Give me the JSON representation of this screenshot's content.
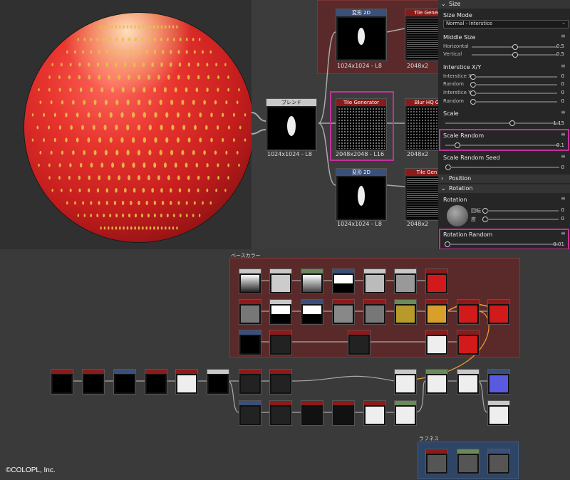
{
  "viewport": {
    "label": "3D Preview"
  },
  "top_graph": {
    "nodes": [
      {
        "title": "変形 2D",
        "caption": "1024x1024 - L8",
        "color": "#3a4f7a"
      },
      {
        "title": "Tile Gener",
        "caption": "2048x2",
        "color": "#8b1a1a"
      },
      {
        "title": "ブレンド",
        "caption": "1024x1024 - L8",
        "color": "#c8c8c8"
      },
      {
        "title": "Tile Generator",
        "caption": "2048x2048 - L16",
        "color": "#8b1a1a"
      },
      {
        "title": "Blur HQ G",
        "caption": "2048x2",
        "color": "#8b1a1a"
      },
      {
        "title": "変形 2D",
        "caption": "1024x1024 - L8",
        "color": "#3a4f7a"
      },
      {
        "title": "Tile Gen",
        "caption": "2048x2",
        "color": "#8b1a1a"
      }
    ]
  },
  "panel": {
    "size_section": "Size",
    "size_mode_label": "Size Mode",
    "size_mode_value": "Normal - Interstice",
    "middle_size_label": "Middle Size",
    "horizontal_label": "Horizontal",
    "horizontal_value": "0.5",
    "horizontal_fraction": 0.5,
    "vertical_label": "Vertical",
    "vertical_value": "0.5",
    "vertical_fraction": 0.5,
    "interstice_label": "Interstice X/Y",
    "interstice_x": "Interstice X",
    "interstice_x_value": "0",
    "random1": "Random",
    "random1_value": "0",
    "interstice_y": "Interstice Y",
    "interstice_y_value": "0",
    "random2": "Random",
    "random2_value": "0",
    "scale_label": "Scale",
    "scale_value": "1.15",
    "scale_fraction": 0.58,
    "scale_random_label": "Scale Random",
    "scale_random_value": "0.1",
    "scale_random_fraction": 0.1,
    "scale_random_seed_label": "Scale Random Seed",
    "scale_random_seed_value": "0",
    "position_section": "Position",
    "rotation_section": "Rotation",
    "rotation_label": "Rotation",
    "rotation_turn_label": "回転",
    "rotation_turn_value": "0",
    "rotation_deg_label": "度",
    "rotation_deg_value": "0",
    "rotation_random_label": "Rotation Random",
    "rotation_random_value": "0.01",
    "rotation_random_fraction": 0.01,
    "menu_icon": "≡"
  },
  "bottom_graph": {
    "frame_red_title": "ベースカラー",
    "frame_blue_title": "ラフネス"
  },
  "copyright": "©COLOPL, Inc.",
  "colors": {
    "highlight": "#c2319b",
    "red_frame": "#5a2a2a",
    "blue_frame": "#2e4566"
  }
}
